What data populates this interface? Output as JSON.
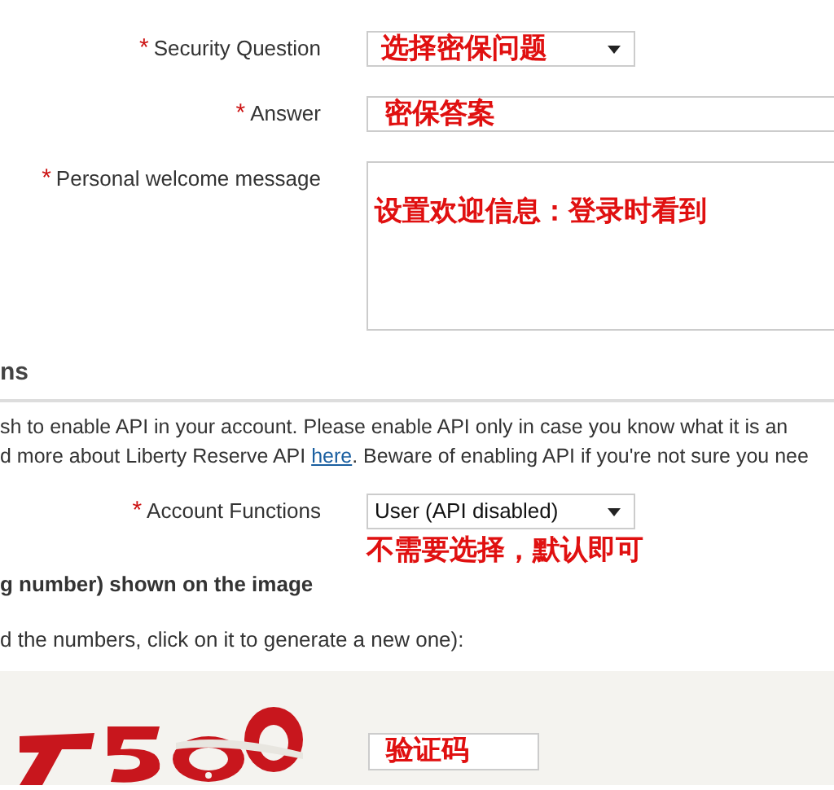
{
  "security_fields": [
    {
      "kind": "select",
      "label": "Security Question",
      "marker": "*",
      "annotation": "选择密保问题"
    },
    {
      "kind": "input",
      "label": "Answer",
      "marker": "*",
      "annotation": "密保答案"
    },
    {
      "kind": "textarea",
      "label": "Personal welcome message",
      "marker": "*",
      "annotation": "设置欢迎信息：登录时看到"
    }
  ],
  "api_section": {
    "heading": "ns",
    "lines": [
      {
        "before": "sh to enable API in your account. Please enable API only in case you know what it is an"
      },
      {
        "before": "d more about Liberty Reserve API ",
        "link": "here",
        "after": ". Beware of enabling API if you're not sure you nee"
      }
    ],
    "field": {
      "label": "Account Functions",
      "marker": "*",
      "value": "User (API disabled)",
      "annotation": "不需要选择，默认即可"
    }
  },
  "captcha": {
    "heading": "g number) shown on the image",
    "hint": "d the numbers, click on it to generate a new one):",
    "annotation": "验证码"
  }
}
